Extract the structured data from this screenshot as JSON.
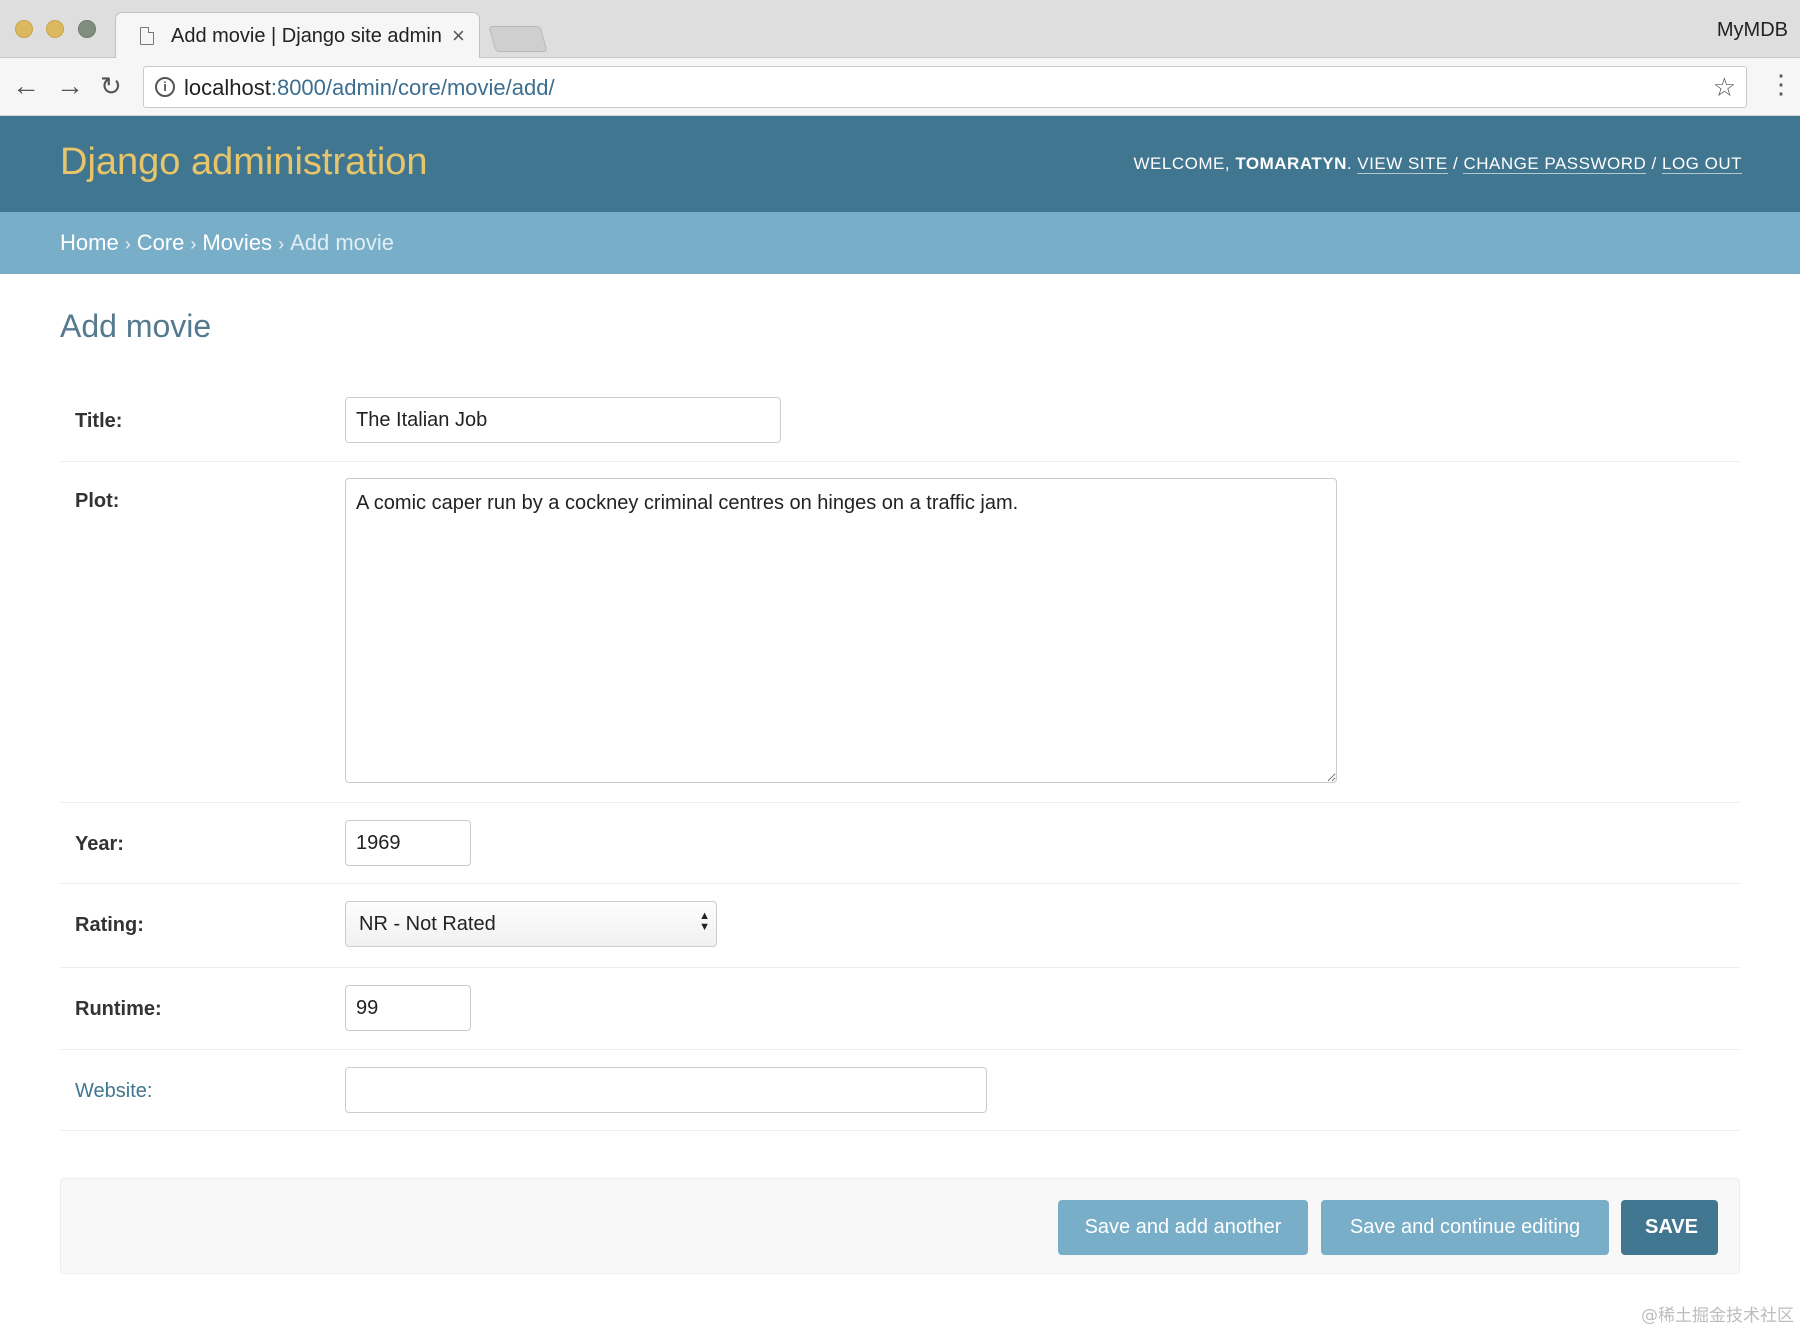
{
  "browser": {
    "tab_title": "Add movie | Django site admin",
    "tab_close": "×",
    "profile_name": "MyMDB",
    "url_host": "localhost",
    "url_rest": ":8000/admin/core/movie/add/",
    "icons": [
      "back-arrow-icon",
      "forward-arrow-icon",
      "reload-icon",
      "info-icon",
      "star-icon",
      "menu-icon",
      "document-icon"
    ]
  },
  "header": {
    "branding": "Django administration",
    "welcome": "WELCOME, ",
    "username": "TOMARATYN",
    "period": ". ",
    "view_site": "VIEW SITE",
    "change_password": "CHANGE PASSWORD",
    "log_out": "LOG OUT",
    "slash": " / "
  },
  "breadcrumbs": {
    "home": "Home",
    "app": "Core",
    "model": "Movies",
    "current": "Add movie",
    "separator": "›"
  },
  "page_title": "Add movie",
  "form": {
    "title": {
      "label": "Title:",
      "value": "The Italian Job"
    },
    "plot": {
      "label": "Plot:",
      "value": "A comic caper run by a cockney criminal centres on hinges on a traffic jam."
    },
    "year": {
      "label": "Year:",
      "value": "1969"
    },
    "rating": {
      "label": "Rating:",
      "value": "NR - Not Rated"
    },
    "runtime": {
      "label": "Runtime:",
      "value": "99"
    },
    "website": {
      "label": "Website:",
      "value": ""
    }
  },
  "buttons": {
    "save_add_another": "Save and add another",
    "save_continue": "Save and continue editing",
    "save": "SAVE"
  },
  "watermark": "@稀土掘金技术社区",
  "colors": {
    "header_bg": "#417690",
    "breadcrumb_bg": "#79aec8",
    "branding": "#e8c56a",
    "button_light": "#79aec8",
    "button_default": "#417690"
  }
}
